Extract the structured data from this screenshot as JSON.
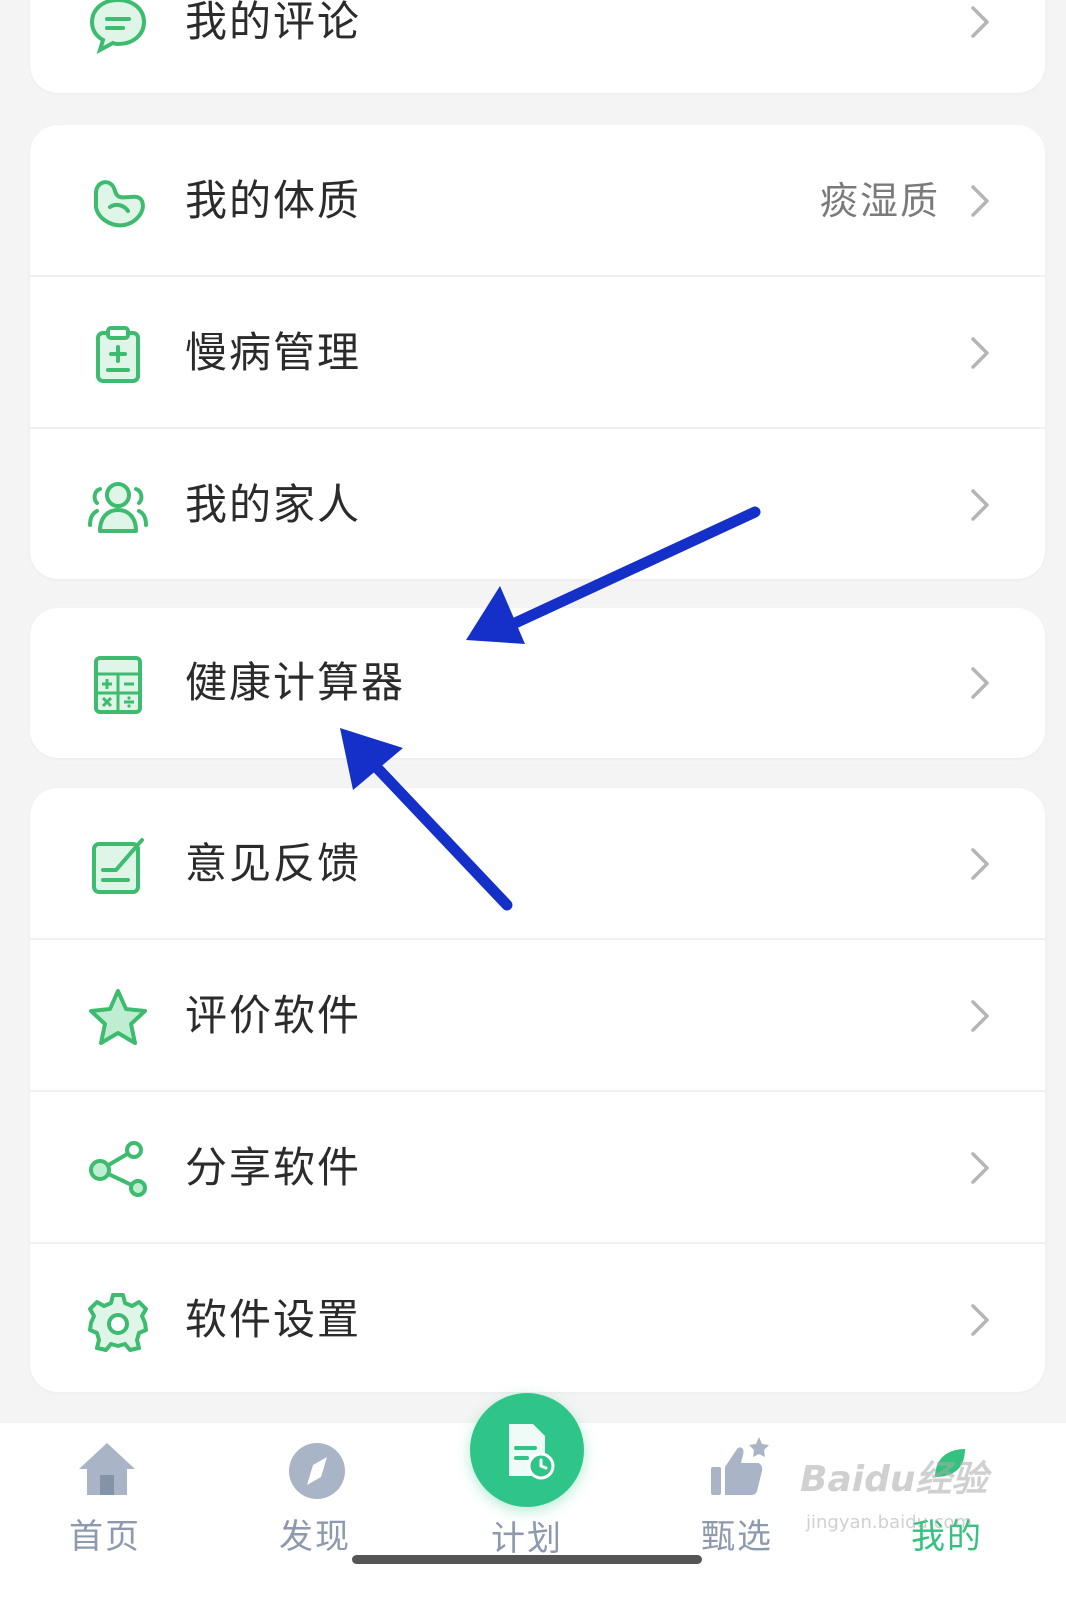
{
  "cards": {
    "c0": {
      "items": [
        {
          "label": "我的评论",
          "icon": "comment-icon"
        }
      ]
    },
    "c1": {
      "items": [
        {
          "label": "我的体质",
          "value": "痰湿质",
          "icon": "body-constitution-icon"
        },
        {
          "label": "慢病管理",
          "icon": "clipboard-plus-icon"
        },
        {
          "label": "我的家人",
          "icon": "family-icon"
        }
      ]
    },
    "c2": {
      "items": [
        {
          "label": "健康计算器",
          "icon": "calculator-icon"
        }
      ]
    },
    "c3": {
      "items": [
        {
          "label": "意见反馈",
          "icon": "feedback-edit-icon"
        },
        {
          "label": "评价软件",
          "icon": "star-icon"
        },
        {
          "label": "分享软件",
          "icon": "share-icon"
        },
        {
          "label": "软件设置",
          "icon": "gear-icon"
        }
      ]
    }
  },
  "nav": {
    "items": [
      {
        "label": "首页",
        "icon": "home-icon"
      },
      {
        "label": "发现",
        "icon": "compass-icon"
      },
      {
        "label": "计划",
        "icon": "plan-document-icon"
      },
      {
        "label": "甄选",
        "icon": "thumbs-up-star-icon"
      },
      {
        "label": "我的",
        "icon": "profile-leaf-icon",
        "active": true
      }
    ]
  },
  "watermark": {
    "brand": "Baidu经验",
    "url": "jingyan.baidu.com"
  },
  "colors": {
    "accent": "#34c27e",
    "arrow": "#1530c8",
    "nav_inactive": "#8d9aae"
  }
}
